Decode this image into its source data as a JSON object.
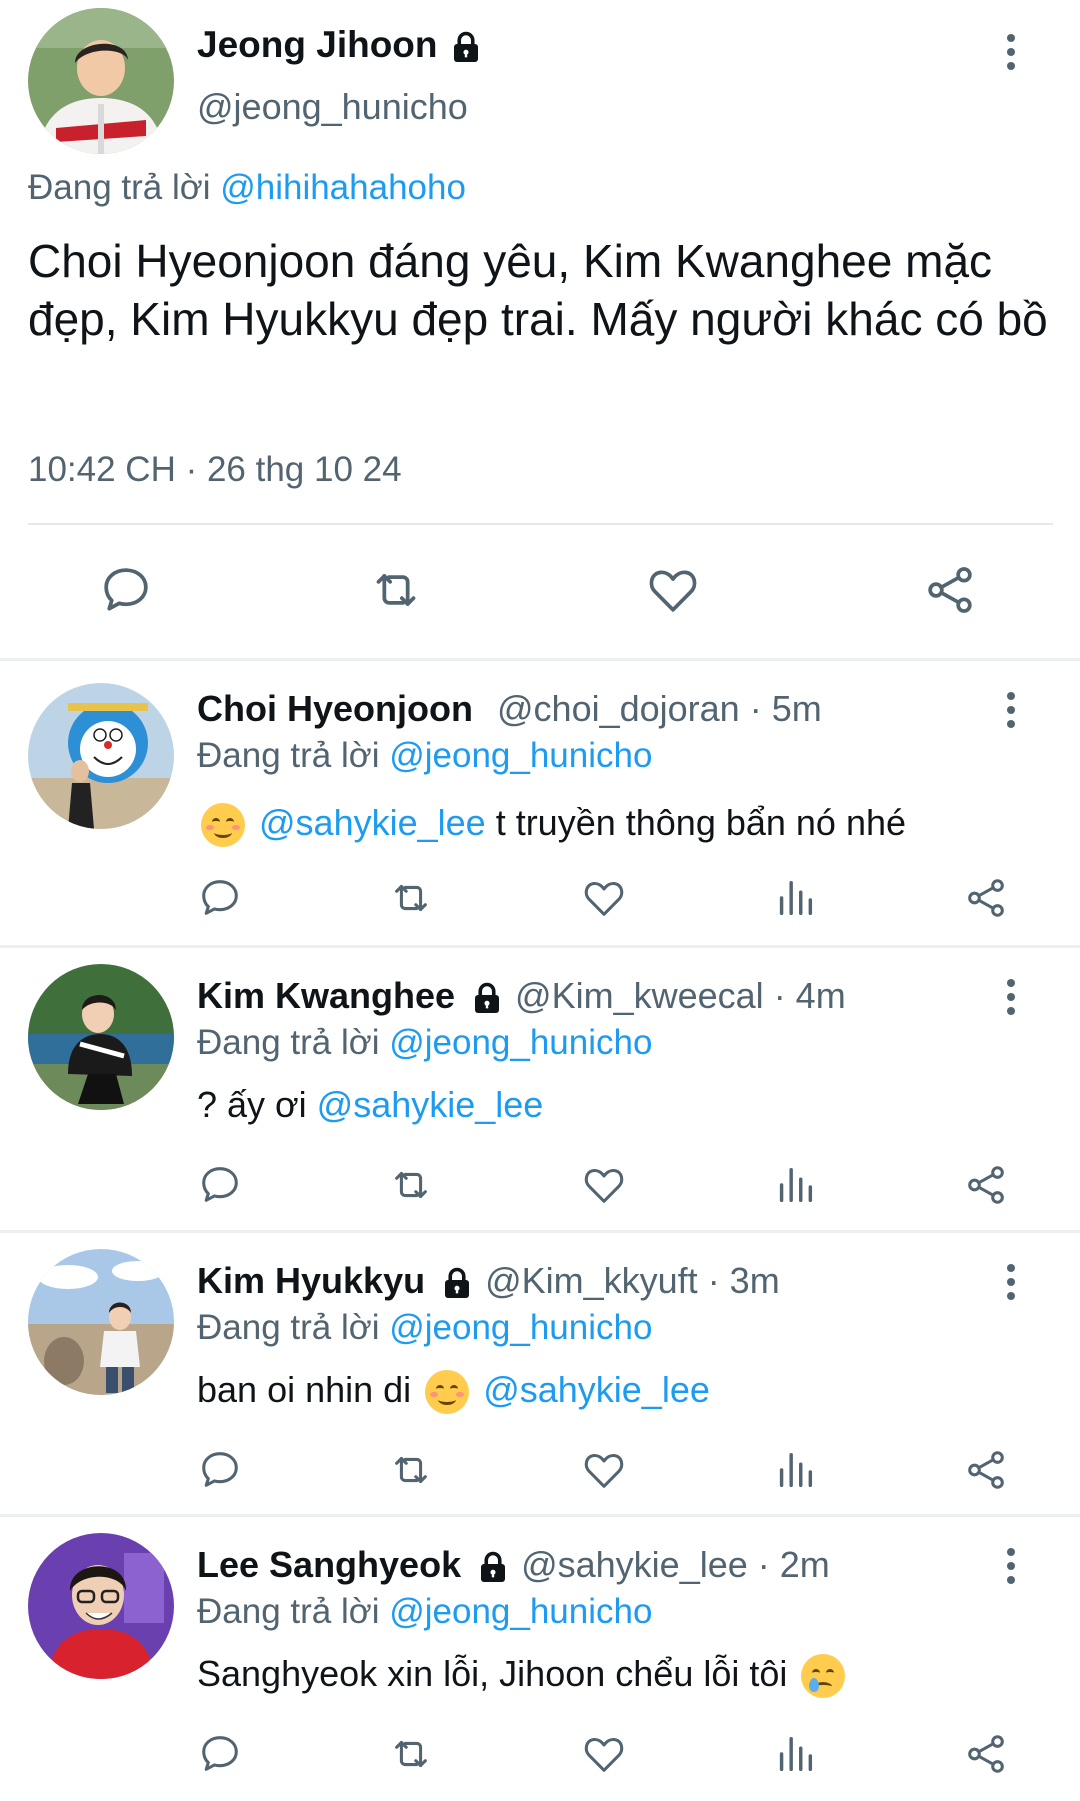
{
  "main_tweet": {
    "name": "Jeong Jihoon",
    "handle": "@jeong_hunicho",
    "reply_prefix": "Đang trả lời",
    "reply_to": "@hihihahahoho",
    "text": "Choi Hyeonjoon đáng yêu, Kim Kwanghee mặc đẹp, Kim Hyukkyu đẹp trai. Mấy người khác có bồ",
    "timestamp": "10:42 CH · 26 thg 10 24"
  },
  "replies": [
    {
      "name": "Choi Hyeonjoon",
      "handle": "@choi_dojoran",
      "time": "· 5m",
      "reply_prefix": "Đang trả lời",
      "reply_to": "@jeong_hunicho",
      "lead": "",
      "mention": "@sahykie_lee",
      "tail": " t truyền thông bẩn nó nhé"
    },
    {
      "name": "Kim Kwanghee",
      "handle": "@Kim_kweecal",
      "time": "· 4m",
      "reply_prefix": "Đang trả lời",
      "reply_to": "@jeong_hunicho",
      "lead": "? ấy ơi ",
      "mention": "@sahykie_lee",
      "tail": ""
    },
    {
      "name": "Kim Hyukkyu",
      "handle": "@Kim_kkyuft",
      "time": "· 3m",
      "reply_prefix": "Đang trả lời",
      "reply_to": "@jeong_hunicho",
      "lead": "ban oi nhin di",
      "mention": "@sahykie_lee",
      "tail": ""
    },
    {
      "name": "Lee Sanghyeok",
      "handle": "@sahykie_lee",
      "time": "· 2m",
      "reply_prefix": "Đang trả lời",
      "reply_to": "@jeong_hunicho",
      "lead": "Sanghyeok xin lỗi, Jihoon chểu lỗi tôi",
      "mention": "",
      "tail": ""
    }
  ],
  "colors": {
    "link": "#1d9bf0",
    "secondary_text": "#536471",
    "divider": "#e6e9ec"
  },
  "icons": [
    "lock-icon",
    "more-options-icon",
    "reply-icon",
    "retweet-icon",
    "like-icon",
    "views-icon",
    "share-icon",
    "smiling-face-emoji",
    "crying-face-emoji"
  ]
}
